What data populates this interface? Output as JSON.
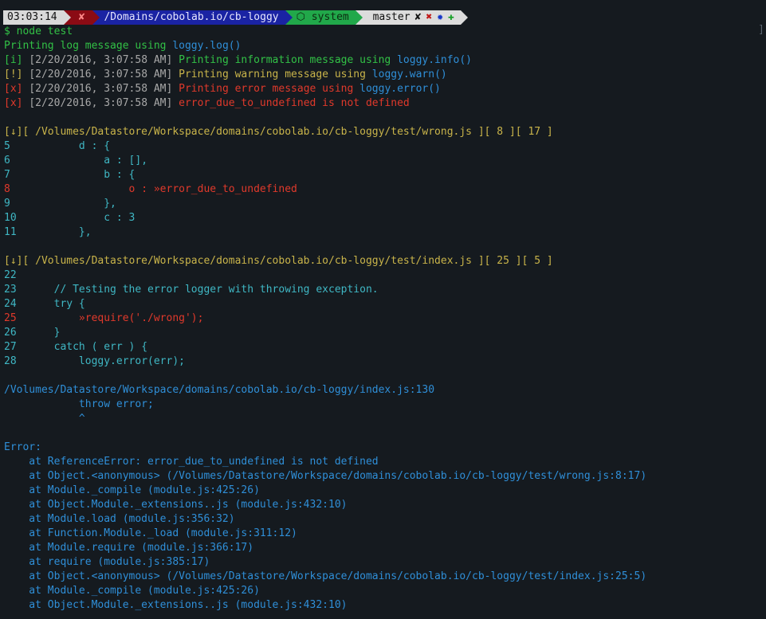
{
  "prompt": {
    "time": "03:03:14",
    "status_mark": "✘",
    "directory": "/Domains/cobolab.io/cb-loggy",
    "env": "⬡ system",
    "git_branch": " master",
    "git_marks": [
      "✘",
      "✖",
      "✹",
      "✚"
    ],
    "colors": {
      "time_bg": "#d9d9d9",
      "error_bg": "#8b0b14",
      "dir_bg": "#1a23a3",
      "env_bg": "#21a84a",
      "git_bg": "#dcdcdc"
    }
  },
  "cursor_glyph": "]",
  "output": {
    "command": "$ node test",
    "log_line": {
      "prefix": "Printing log message using ",
      "call": "loggy.log()"
    },
    "info_line": {
      "tag": "[i]",
      "time": "[2/20/2016, 3:07:58 AM]",
      "text": "Printing information message using ",
      "call": "loggy.info()"
    },
    "warn_line": {
      "tag": "[!]",
      "time": "[2/20/2016, 3:07:58 AM]",
      "text": "Printing warning message using ",
      "call": "loggy.warn()"
    },
    "error_line": {
      "tag": "[x]",
      "time": "[2/20/2016, 3:07:58 AM]",
      "text": "Printing error message using ",
      "call": "loggy.error()"
    },
    "error_line2": {
      "tag": "[x]",
      "time": "[2/20/2016, 3:07:58 AM]",
      "text": "error_due_to_undefined is not defined"
    },
    "trace1_header": "[↓][ /Volumes/Datastore/Workspace/domains/cobolab.io/cb-loggy/test/wrong.js ][ 8 ][ 17 ]",
    "trace1_code": [
      {
        "num": "5",
        "code": "        d : {"
      },
      {
        "num": "6",
        "code": "            a : [],"
      },
      {
        "num": "7",
        "code": "            b : {"
      },
      {
        "num": "8",
        "code": "                o : »error_due_to_undefined"
      },
      {
        "num": "9",
        "code": "            },"
      },
      {
        "num": "10",
        "code": "            c : 3"
      },
      {
        "num": "11",
        "code": "        },"
      }
    ],
    "trace2_header": "[↓][ /Volumes/Datastore/Workspace/domains/cobolab.io/cb-loggy/test/index.js ][ 25 ][ 5 ]",
    "trace2_code": [
      {
        "num": "22",
        "code": ""
      },
      {
        "num": "23",
        "code": "    // Testing the error logger with throwing exception."
      },
      {
        "num": "24",
        "code": "    try {"
      },
      {
        "num": "25",
        "code": "        »require('./wrong');"
      },
      {
        "num": "26",
        "code": "    }"
      },
      {
        "num": "27",
        "code": "    catch ( err ) {"
      },
      {
        "num": "28",
        "code": "        loggy.error(err);"
      }
    ],
    "throw_location": "/Volumes/Datastore/Workspace/domains/cobolab.io/cb-loggy/index.js:130",
    "throw_code": "            throw error;",
    "throw_caret": "            ^",
    "error_title": "Error:",
    "stack": [
      "    at ReferenceError: error_due_to_undefined is not defined",
      "    at Object.<anonymous> (/Volumes/Datastore/Workspace/domains/cobolab.io/cb-loggy/test/wrong.js:8:17)",
      "    at Module._compile (module.js:425:26)",
      "    at Object.Module._extensions..js (module.js:432:10)",
      "    at Module.load (module.js:356:32)",
      "    at Function.Module._load (module.js:311:12)",
      "    at Module.require (module.js:366:17)",
      "    at require (module.js:385:17)",
      "    at Object.<anonymous> (/Volumes/Datastore/Workspace/domains/cobolab.io/cb-loggy/test/index.js:25:5)",
      "    at Module._compile (module.js:425:26)",
      "    at Object.Module._extensions..js (module.js:432:10)"
    ]
  }
}
